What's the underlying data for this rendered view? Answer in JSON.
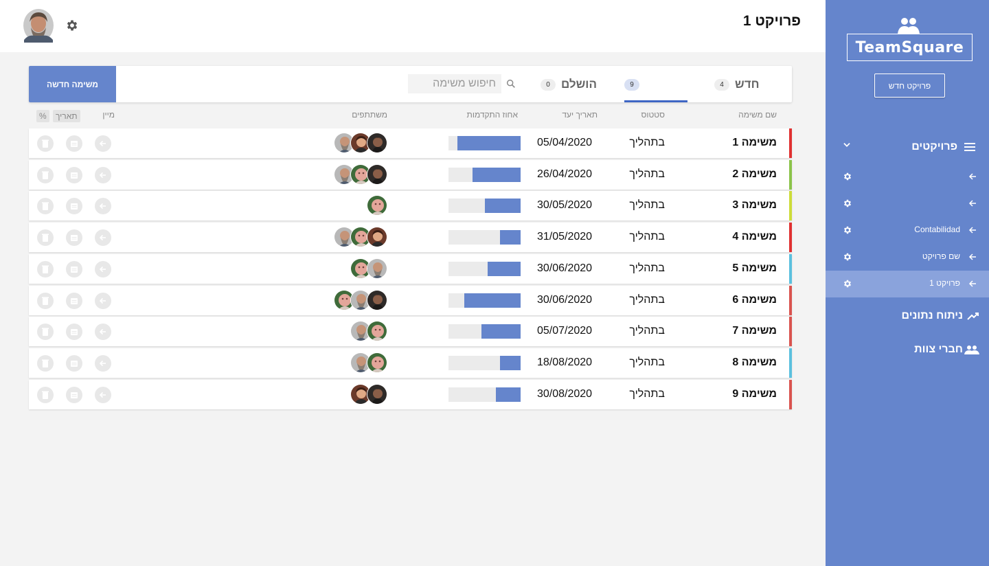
{
  "sidebar": {
    "logo": "TeamSquare",
    "new_project_label": "פרויקט חדש",
    "projects_label": "פרויקטים",
    "projects": [
      {
        "label": "",
        "active": false
      },
      {
        "label": "",
        "active": false
      },
      {
        "label": "Contabilidad",
        "active": false
      },
      {
        "label": "שם פרויקט",
        "active": false
      },
      {
        "label": "פרויקט 1",
        "active": true
      }
    ],
    "analytics_label": "ניתוח נתונים",
    "team_label": "חברי צוות"
  },
  "header": {
    "title": "פרויקט 1"
  },
  "toolbar": {
    "new_task_label": "משימה חדשה",
    "search_placeholder": "חיפוש משימה",
    "tabs": [
      {
        "label": "חדש",
        "count": "4",
        "active": false
      },
      {
        "label": "",
        "count": "9",
        "active": true
      },
      {
        "label": "הושלם",
        "count": "0",
        "active": false
      }
    ]
  },
  "table": {
    "columns": {
      "name": "שם משימה",
      "status": "סטטוס",
      "due": "תאריך יעד",
      "progress": "אחוז התקדמות",
      "members": "משתתפים",
      "sort": "מיין",
      "sort_date": "תאריך",
      "sort_pct": "%"
    },
    "rows": [
      {
        "name": "משימה 1",
        "status": "בתהליך",
        "due": "05/04/2020",
        "progress": 0.88,
        "stripe": "#e03131",
        "members": [
          "a",
          "b",
          "c"
        ]
      },
      {
        "name": "משימה 2",
        "status": "בתהליך",
        "due": "26/04/2020",
        "progress": 0.67,
        "stripe": "#8bc34a",
        "members": [
          "a",
          "d",
          "c"
        ]
      },
      {
        "name": "משימה 3",
        "status": "בתהליך",
        "due": "30/05/2020",
        "progress": 0.5,
        "stripe": "#cddc39",
        "members": [
          "d"
        ]
      },
      {
        "name": "משימה 4",
        "status": "בתהליך",
        "due": "31/05/2020",
        "progress": 0.29,
        "stripe": "#e03131",
        "members": [
          "b",
          "d",
          "c"
        ]
      },
      {
        "name": "משימה 5",
        "status": "בתהליך",
        "due": "30/06/2020",
        "progress": 0.46,
        "stripe": "#5bc0de",
        "members": [
          "c",
          "d"
        ]
      },
      {
        "name": "משימה 6",
        "status": "בתהליך",
        "due": "30/06/2020",
        "progress": 0.78,
        "stripe": "#d9534f",
        "members": [
          "a",
          "c",
          "d"
        ]
      },
      {
        "name": "משימה 7",
        "status": "בתהליך",
        "due": "05/07/2020",
        "progress": 0.54,
        "stripe": "#d9534f",
        "members": [
          "d",
          "c"
        ]
      },
      {
        "name": "משימה 8",
        "status": "בתהליך",
        "due": "18/08/2020",
        "progress": 0.29,
        "stripe": "#5bc0de",
        "members": [
          "d",
          "c"
        ]
      },
      {
        "name": "משימה 9",
        "status": "בתהליך",
        "due": "30/08/2020",
        "progress": 0.34,
        "stripe": "#d9534f",
        "members": [
          "a",
          "b"
        ]
      }
    ]
  },
  "colors": {
    "accent": "#6585cc",
    "accent_dark": "#3f66c4",
    "sidebar_active": "#8aa3dc"
  },
  "icons": {
    "sidebar_logo": "team-icon",
    "projects": "list-icon",
    "project_item": "arrow-left-icon",
    "project_settings": "gear-icon",
    "analytics": "trending-up-icon",
    "team": "people-icon",
    "search": "search-icon",
    "row_actions": [
      "trash-icon",
      "calendar-icon",
      "arrow-left-icon"
    ]
  }
}
